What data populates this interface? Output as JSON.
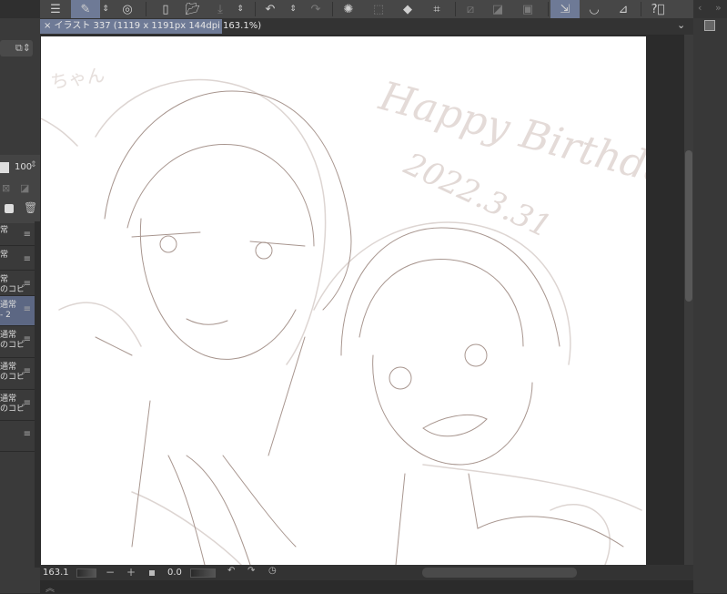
{
  "toolbar": {
    "items": [
      "menu-icon",
      "pen-edit-icon",
      "chevrons-icon",
      "lasso-icon",
      "new-canvas-icon",
      "open-folder-icon",
      "save-icon",
      "chevrons-icon",
      "undo-icon",
      "chevrons-icon",
      "redo-icon",
      "spinner-icon",
      "select-all-icon",
      "fill-icon",
      "crop-icon",
      "deselect-icon",
      "invert-selection-icon",
      "selection-mask-icon",
      "vector-line-icon",
      "bowl-brush-icon",
      "ruler-icon",
      "help-icon"
    ],
    "selected": [
      "pen-edit-icon",
      "vector-line-icon"
    ],
    "accent": "#6e7a96"
  },
  "document_tab": {
    "label": "× イラスト 337 (1119 x 1191px 144dpi 163.1%)"
  },
  "layer_panel": {
    "opacity": "100",
    "layers": [
      {
        "name": "常",
        "sub": ""
      },
      {
        "name": "常",
        "sub": ""
      },
      {
        "name": "常",
        "sub": "のコピ"
      },
      {
        "name": "通常",
        "sub": "- 2",
        "selected": true
      },
      {
        "name": "通常",
        "sub": "のコピ"
      },
      {
        "name": "通常",
        "sub": "のコピ"
      },
      {
        "name": "通常",
        "sub": "のコピ"
      },
      {
        "name": "",
        "sub": ""
      }
    ]
  },
  "artwork": {
    "lettering": "Happy Birthday",
    "date": "2022.3.31",
    "corner_text": "ちゃん"
  },
  "status": {
    "zoom": "163.1",
    "rotation": "0.0",
    "zoom_out": "−",
    "zoom_in": "+"
  }
}
